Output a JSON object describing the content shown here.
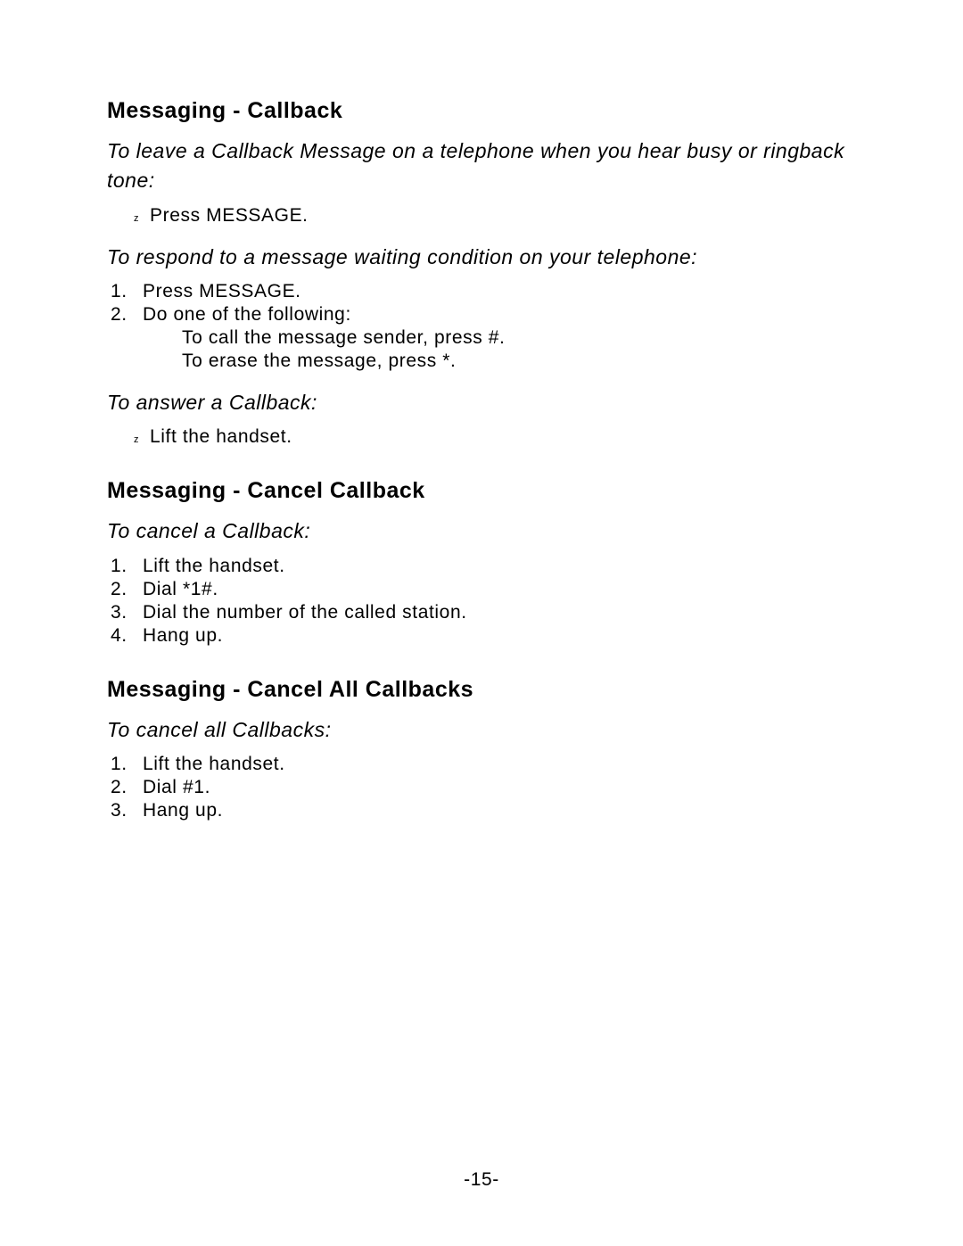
{
  "sections": [
    {
      "heading": "Messaging - Callback",
      "parts": [
        {
          "scenario": "To leave a Callback Message on a telephone when you hear busy or ringback tone:",
          "bullets": [
            "Press MESSAGE."
          ]
        },
        {
          "scenario": "To respond to a message waiting condition on your telephone:",
          "numbered": [
            {
              "text": "Press MESSAGE."
            },
            {
              "text": "Do one of the following:",
              "sub": [
                "To call the message sender, press #.",
                "To erase the message, press *."
              ]
            }
          ]
        },
        {
          "scenario": "To answer a Callback:",
          "bullets": [
            "Lift the handset."
          ]
        }
      ]
    },
    {
      "heading": "Messaging - Cancel Callback",
      "parts": [
        {
          "scenario": "To cancel a Callback:",
          "numbered": [
            {
              "text": "Lift the handset."
            },
            {
              "text": "Dial *1#."
            },
            {
              "text": "Dial the number of the called station."
            },
            {
              "text": "Hang up."
            }
          ]
        }
      ]
    },
    {
      "heading": "Messaging - Cancel All Callbacks",
      "parts": [
        {
          "scenario": "To cancel all Callbacks:",
          "numbered": [
            {
              "text": "Lift the handset."
            },
            {
              "text": "Dial #1."
            },
            {
              "text": "Hang up."
            }
          ]
        }
      ]
    }
  ],
  "bullet_glyph": "z",
  "page_number": "-15-"
}
